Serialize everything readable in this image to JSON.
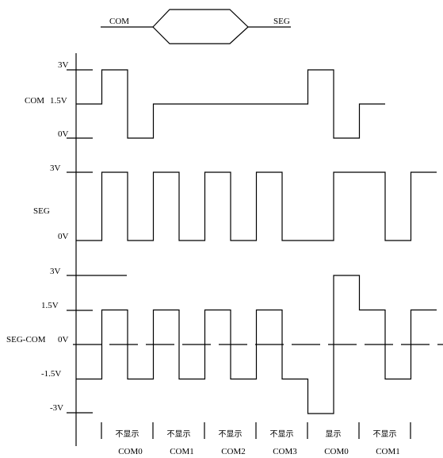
{
  "header": {
    "left_label": "COM",
    "right_label": "SEG"
  },
  "com_section": {
    "name": "COM",
    "levels": [
      "3V",
      "1.5V",
      "0V"
    ],
    "waveform_volts": [
      1.5,
      3,
      0,
      1.5,
      1.5,
      1.5,
      1.5,
      1.5,
      1.5,
      3,
      0,
      1.5
    ]
  },
  "seg_section": {
    "name": "SEG",
    "levels": [
      "3V",
      "0V"
    ],
    "waveform_volts": [
      0,
      3,
      0,
      3,
      0,
      3,
      0,
      3,
      0,
      0,
      3,
      3,
      0,
      3
    ]
  },
  "segcom_section": {
    "name": "SEG-COM",
    "levels": [
      "3V",
      "1.5V",
      "0V",
      "-1.5V",
      "-3V"
    ],
    "waveform_volts": [
      -1.5,
      1.5,
      -1.5,
      1.5,
      -1.5,
      1.5,
      -1.5,
      1.5,
      -1.5,
      -3,
      3,
      1.5,
      -1.5,
      1.5
    ]
  },
  "frames": [
    {
      "state": "不显示",
      "com": "COM0"
    },
    {
      "state": "不显示",
      "com": "COM1"
    },
    {
      "state": "不显示",
      "com": "COM2"
    },
    {
      "state": "不显示",
      "com": "COM3"
    },
    {
      "state": "显示",
      "com": "COM0"
    },
    {
      "state": "不显示",
      "com": "COM1"
    }
  ]
}
